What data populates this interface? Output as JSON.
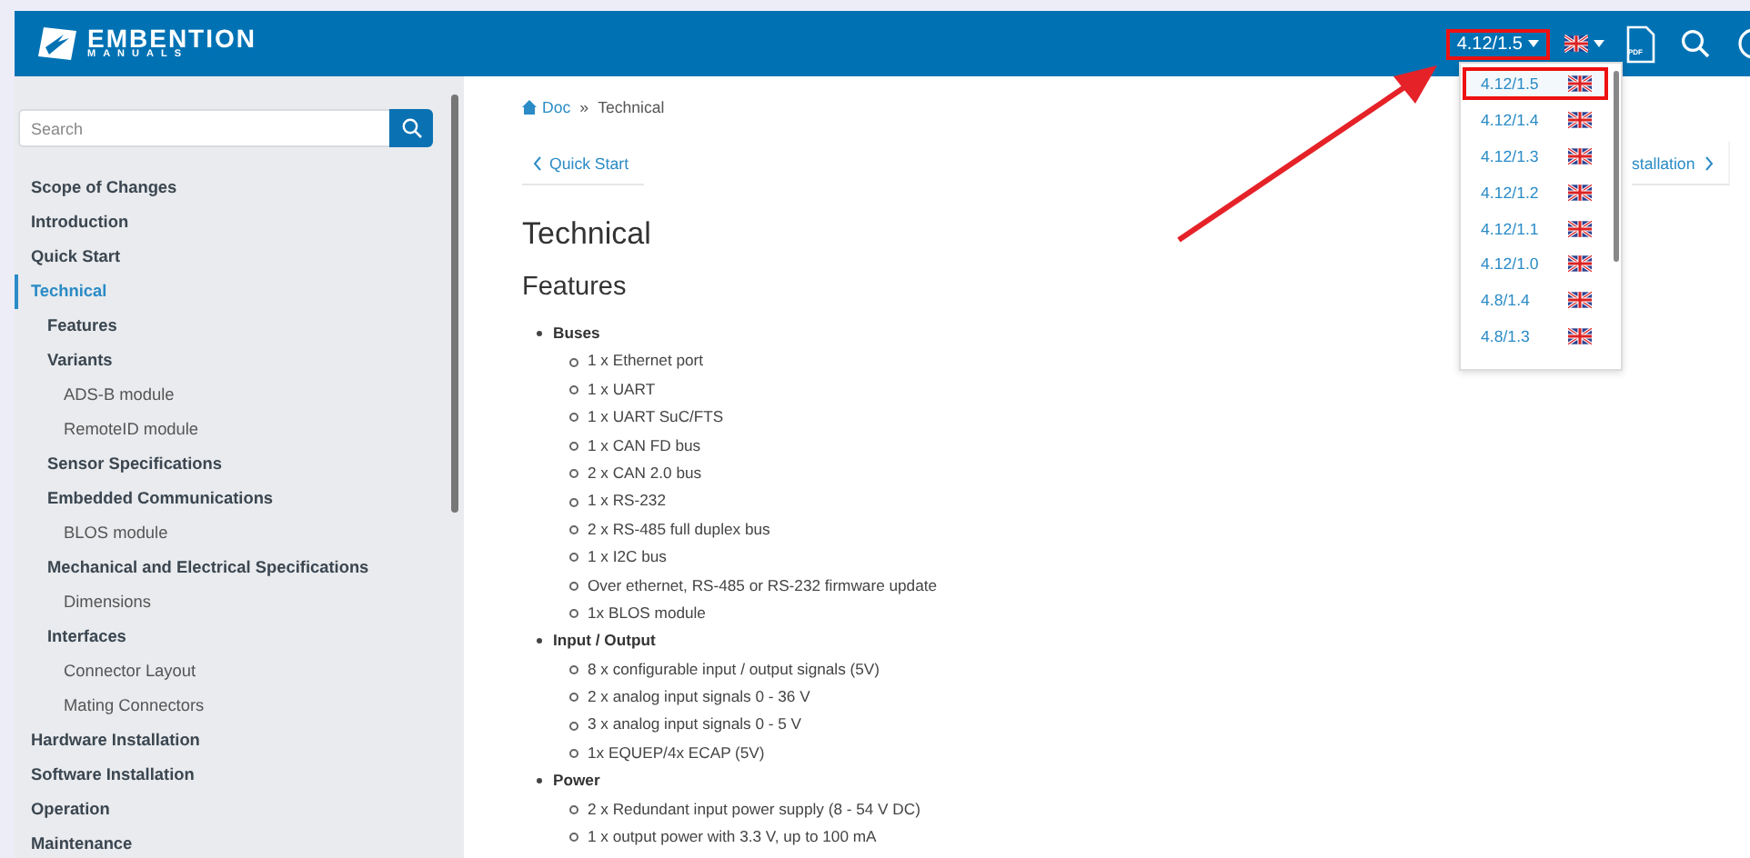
{
  "header": {
    "logo": {
      "name": "EMBENTION",
      "tagline": "MANUALS"
    },
    "version": {
      "label": "4.12/1.5",
      "highlighted": true
    },
    "pdf_label": "PDF"
  },
  "version_menu": [
    {
      "label": "4.12/1.5",
      "selected": true,
      "highlighted": true
    },
    {
      "label": "4.12/1.4",
      "selected": false,
      "highlighted": false
    },
    {
      "label": "4.12/1.3",
      "selected": false,
      "highlighted": false
    },
    {
      "label": "4.12/1.2",
      "selected": false,
      "highlighted": false
    },
    {
      "label": "4.12/1.1",
      "selected": false,
      "highlighted": false
    },
    {
      "label": "4.12/1.0",
      "selected": false,
      "highlighted": false
    },
    {
      "label": "4.8/1.4",
      "selected": false,
      "highlighted": false
    },
    {
      "label": "4.8/1.3",
      "selected": false,
      "highlighted": false
    }
  ],
  "sidebar": {
    "search": {
      "placeholder": "Search"
    },
    "items": [
      {
        "label": "Scope of Changes",
        "selected": false
      },
      {
        "label": "Introduction",
        "selected": false
      },
      {
        "label": "Quick Start",
        "selected": false
      },
      {
        "label": "Technical",
        "selected": true,
        "children": [
          {
            "label": "Features",
            "selected": false
          },
          {
            "label": "Variants",
            "selected": false,
            "children": [
              {
                "label": "ADS-B module",
                "selected": false
              },
              {
                "label": "RemoteID module",
                "selected": false
              }
            ]
          },
          {
            "label": "Sensor Specifications",
            "selected": false
          },
          {
            "label": "Embedded Communications",
            "selected": false,
            "children": [
              {
                "label": "BLOS module",
                "selected": false
              }
            ]
          },
          {
            "label": "Mechanical and Electrical Specifications",
            "selected": false,
            "children": [
              {
                "label": "Dimensions",
                "selected": false
              }
            ]
          },
          {
            "label": "Interfaces",
            "selected": false,
            "children": [
              {
                "label": "Connector Layout",
                "selected": false
              },
              {
                "label": "Mating Connectors",
                "selected": false
              }
            ]
          }
        ]
      },
      {
        "label": "Hardware Installation",
        "selected": false
      },
      {
        "label": "Software Installation",
        "selected": false
      },
      {
        "label": "Operation",
        "selected": false
      },
      {
        "label": "Maintenance",
        "selected": false
      }
    ]
  },
  "content": {
    "breadcrumb": [
      "Doc",
      "Technical"
    ],
    "breadcrumb_separator": "»",
    "prev_link": "Quick Start",
    "next_link": "stallation",
    "title": "Technical",
    "section": "Features",
    "features": [
      {
        "title": "Buses",
        "items": [
          "1 x Ethernet port",
          "1 x UART",
          "1 x UART SuC/FTS",
          "1 x CAN FD bus",
          "2 x CAN 2.0 bus",
          "1 x RS-232",
          "2 x RS-485 full duplex bus",
          "1 x I2C bus",
          "Over ethernet, RS-485 or RS-232 firmware update",
          "1x BLOS module"
        ]
      },
      {
        "title": "Input / Output",
        "items": [
          "8 x configurable input / output signals (5V)",
          "2 x analog input signals 0 - 36 V",
          "3 x analog input signals 0 - 5 V",
          "1x EQUEP/4x ECAP (5V)"
        ]
      },
      {
        "title": "Power",
        "items": [
          "2 x Redundant input power supply (8 - 54 V DC)",
          "1 x output power with 3.3 V, up to 100 mA"
        ]
      }
    ]
  }
}
